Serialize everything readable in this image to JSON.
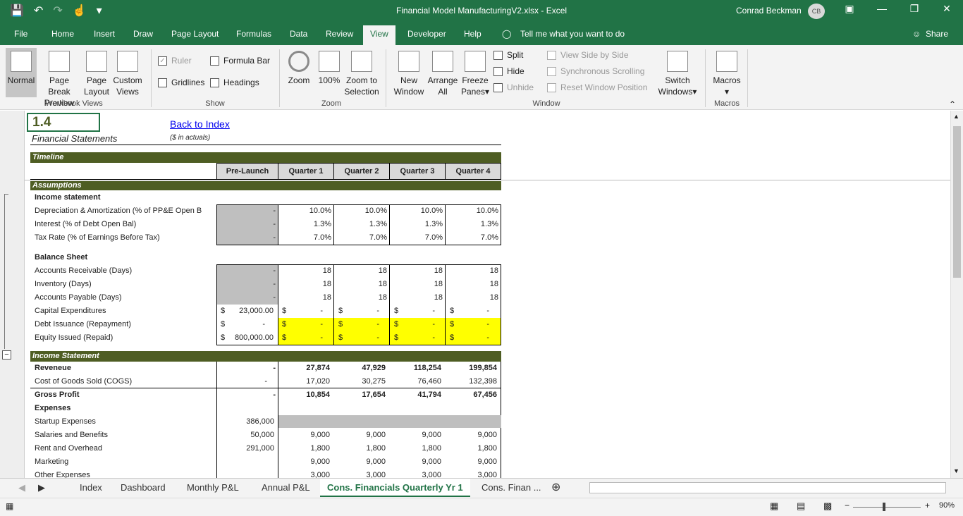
{
  "app": {
    "title": "Financial Model ManufacturingV2.xlsx  -  Excel",
    "user": "Conrad Beckman",
    "initials": "CB"
  },
  "menu_tabs": [
    "File",
    "Home",
    "Insert",
    "Draw",
    "Page Layout",
    "Formulas",
    "Data",
    "Review",
    "View",
    "Developer",
    "Help"
  ],
  "active_tab": "View",
  "tell_me": "Tell me what you want to do",
  "share": "Share",
  "ribbon": {
    "workbook_views": {
      "normal": "Normal",
      "page_break": "Page Break",
      "page_break2": "Preview",
      "page_layout": "Page",
      "page_layout2": "Layout",
      "custom": "Custom",
      "custom2": "Views",
      "group": "Workbook Views"
    },
    "show": {
      "ruler": "Ruler",
      "formula_bar": "Formula Bar",
      "gridlines": "Gridlines",
      "headings": "Headings",
      "group": "Show"
    },
    "zoom": {
      "zoom": "Zoom",
      "hundred": "100%",
      "zoom_sel": "Zoom to",
      "zoom_sel2": "Selection",
      "group": "Zoom"
    },
    "window": {
      "new": "New",
      "new2": "Window",
      "arrange": "Arrange",
      "arrange2": "All",
      "freeze": "Freeze",
      "freeze2": "Panes",
      "split": "Split",
      "hide": "Hide",
      "unhide": "Unhide",
      "side": "View Side by Side",
      "sync": "Synchronous Scrolling",
      "reset": "Reset Window Position",
      "switch": "Switch",
      "switch2": "Windows",
      "group": "Window"
    },
    "macros": {
      "label": "Macros",
      "group": "Macros"
    }
  },
  "sheet": {
    "cell_ref": "1.4",
    "subtitle": "Financial Statements",
    "back_link": "Back to Index",
    "units": "($ in actuals)",
    "timeline_label": "Timeline",
    "periods": [
      "Pre-Launch",
      "Quarter 1",
      "Quarter 2",
      "Quarter 3",
      "Quarter 4"
    ],
    "assumptions_label": "Assumptions",
    "income_statement_hdr": "Income statement",
    "dep": {
      "label": "Depreciation & Amortization (% of PP&E Open B",
      "pre": "-",
      "q": [
        "10.0%",
        "10.0%",
        "10.0%",
        "10.0%"
      ]
    },
    "interest": {
      "label": "Interest (% of Debt Open Bal)",
      "pre": "-",
      "q": [
        "1.3%",
        "1.3%",
        "1.3%",
        "1.3%"
      ]
    },
    "tax": {
      "label": "Tax Rate (% of Earnings Before Tax)",
      "pre": "-",
      "q": [
        "7.0%",
        "7.0%",
        "7.0%",
        "7.0%"
      ]
    },
    "balance_sheet_hdr": "Balance Sheet",
    "ar": {
      "label": "Accounts Receivable (Days)",
      "pre": "-",
      "q": [
        "18",
        "18",
        "18",
        "18"
      ]
    },
    "inv": {
      "label": "Inventory (Days)",
      "pre": "-",
      "q": [
        "18",
        "18",
        "18",
        "18"
      ]
    },
    "ap": {
      "label": "Accounts Payable (Days)",
      "pre": "-",
      "q": [
        "18",
        "18",
        "18",
        "18"
      ]
    },
    "capex": {
      "label": "Capital Expenditures",
      "pre": "23,000.00",
      "q": [
        "-",
        "-",
        "-",
        "-"
      ]
    },
    "debt": {
      "label": "Debt Issuance (Repayment)",
      "pre": "-",
      "q": [
        "-",
        "-",
        "-",
        "-"
      ]
    },
    "equity": {
      "label": "Equity Issued (Repaid)",
      "pre": "800,000.00",
      "q": [
        "-",
        "-",
        "-",
        "-"
      ]
    },
    "dollar": "$",
    "is_label": "Income Statement",
    "revenue": {
      "label": "Reveneue",
      "pre": "-",
      "q": [
        "27,874",
        "47,929",
        "118,254",
        "199,854"
      ]
    },
    "cogs": {
      "label": "Cost of Goods Sold (COGS)",
      "pre": "-",
      "q": [
        "17,020",
        "30,275",
        "76,460",
        "132,398"
      ]
    },
    "gross": {
      "label": "Gross Profit",
      "pre": "-",
      "q": [
        "10,854",
        "17,654",
        "41,794",
        "67,456"
      ]
    },
    "expenses_hdr": "Expenses",
    "startup": {
      "label": "Startup Expenses",
      "pre": "386,000"
    },
    "salaries": {
      "label": "Salaries and Benefits",
      "pre": "50,000",
      "q": [
        "9,000",
        "9,000",
        "9,000",
        "9,000"
      ]
    },
    "rent": {
      "label": "Rent and Overhead",
      "pre": "291,000",
      "q": [
        "1,800",
        "1,800",
        "1,800",
        "1,800"
      ]
    },
    "marketing": {
      "label": "Marketing",
      "q": [
        "9,000",
        "9,000",
        "9,000",
        "9,000"
      ]
    },
    "other": {
      "label": "Other Expenses",
      "q": [
        "3,000",
        "3,000",
        "3,000",
        "3,000"
      ]
    }
  },
  "sheet_tabs": [
    "Index",
    "Dashboard",
    "Monthly P&L",
    "Annual P&L",
    "Cons. Financials Quarterly Yr 1",
    "Cons. Finan ..."
  ],
  "active_sheet": "Cons. Financials Quarterly Yr 1",
  "zoom_level": "90%"
}
